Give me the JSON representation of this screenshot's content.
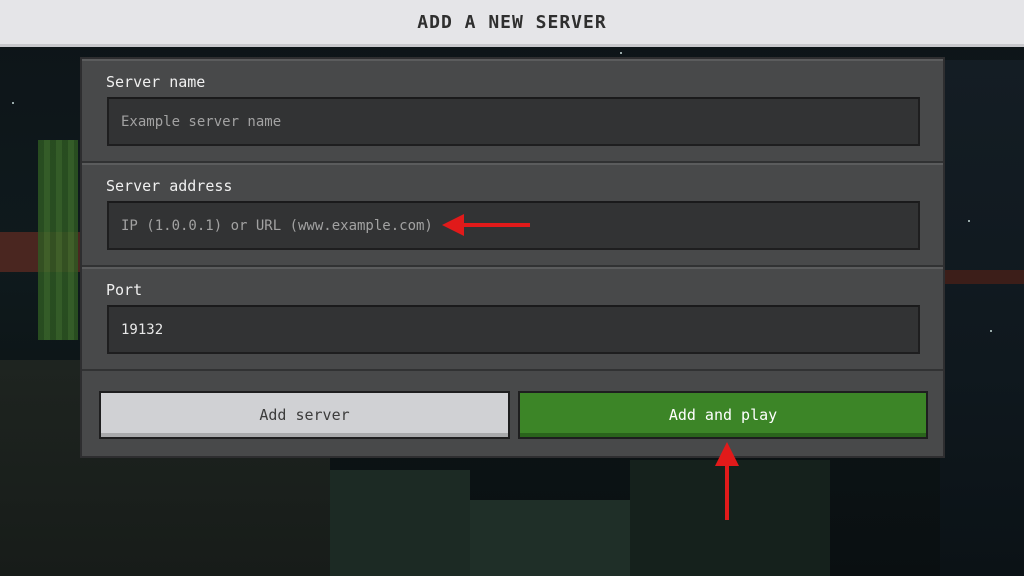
{
  "header": {
    "title": "ADD A NEW SERVER"
  },
  "form": {
    "server_name": {
      "label": "Server name",
      "value": "",
      "placeholder": "Example server name"
    },
    "server_address": {
      "label": "Server address",
      "value": "",
      "placeholder": "IP (1.0.0.1) or URL (www.example.com)"
    },
    "port": {
      "label": "Port",
      "value": "19132",
      "placeholder": ""
    }
  },
  "buttons": {
    "add_server": "Add server",
    "add_and_play": "Add and play"
  },
  "annotations": {
    "arrow_color": "#e11a1a"
  },
  "colors": {
    "primary_button": "#3c8527",
    "panel": "#48494a",
    "header": "#e5e5e8"
  }
}
